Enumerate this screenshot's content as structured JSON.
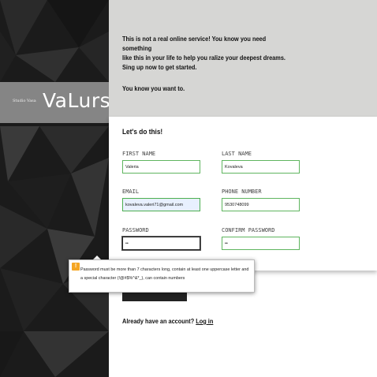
{
  "brand": {
    "small": "Studio Vasa",
    "big": "VaLurs"
  },
  "intro": {
    "lines": [
      "This is not a real online service! You know you need something",
      "like this in your life to help you ralize your deepest dreams.",
      "Sing up now to get started."
    ],
    "tagline": "You know you want to."
  },
  "form": {
    "heading": "Let's do this!",
    "first_name": {
      "label": "FIRST NAME",
      "value": "Valeria"
    },
    "last_name": {
      "label": "LAST NAME",
      "value": "Kovaleva"
    },
    "email": {
      "label": "EMAIL",
      "value": "kovaleva.valeri71@gmail.com"
    },
    "phone": {
      "label": "PHONE NUMBER",
      "value": "9530748099"
    },
    "password": {
      "label": "PASSWORD",
      "value": "••"
    },
    "confirm_password": {
      "label": "CONFIRM PASSWORD",
      "value": "••"
    }
  },
  "tooltip": {
    "icon": "!",
    "message": "Password must be more than 7 characters long, contain at least one uppercase letter and a special character (!@#$%^&*_), can contain numbers"
  },
  "footer": {
    "text": "Already have an account? ",
    "login_link": "Log in"
  },
  "colors": {
    "field_border": "#5fb55f",
    "warning": "#f5a623"
  }
}
